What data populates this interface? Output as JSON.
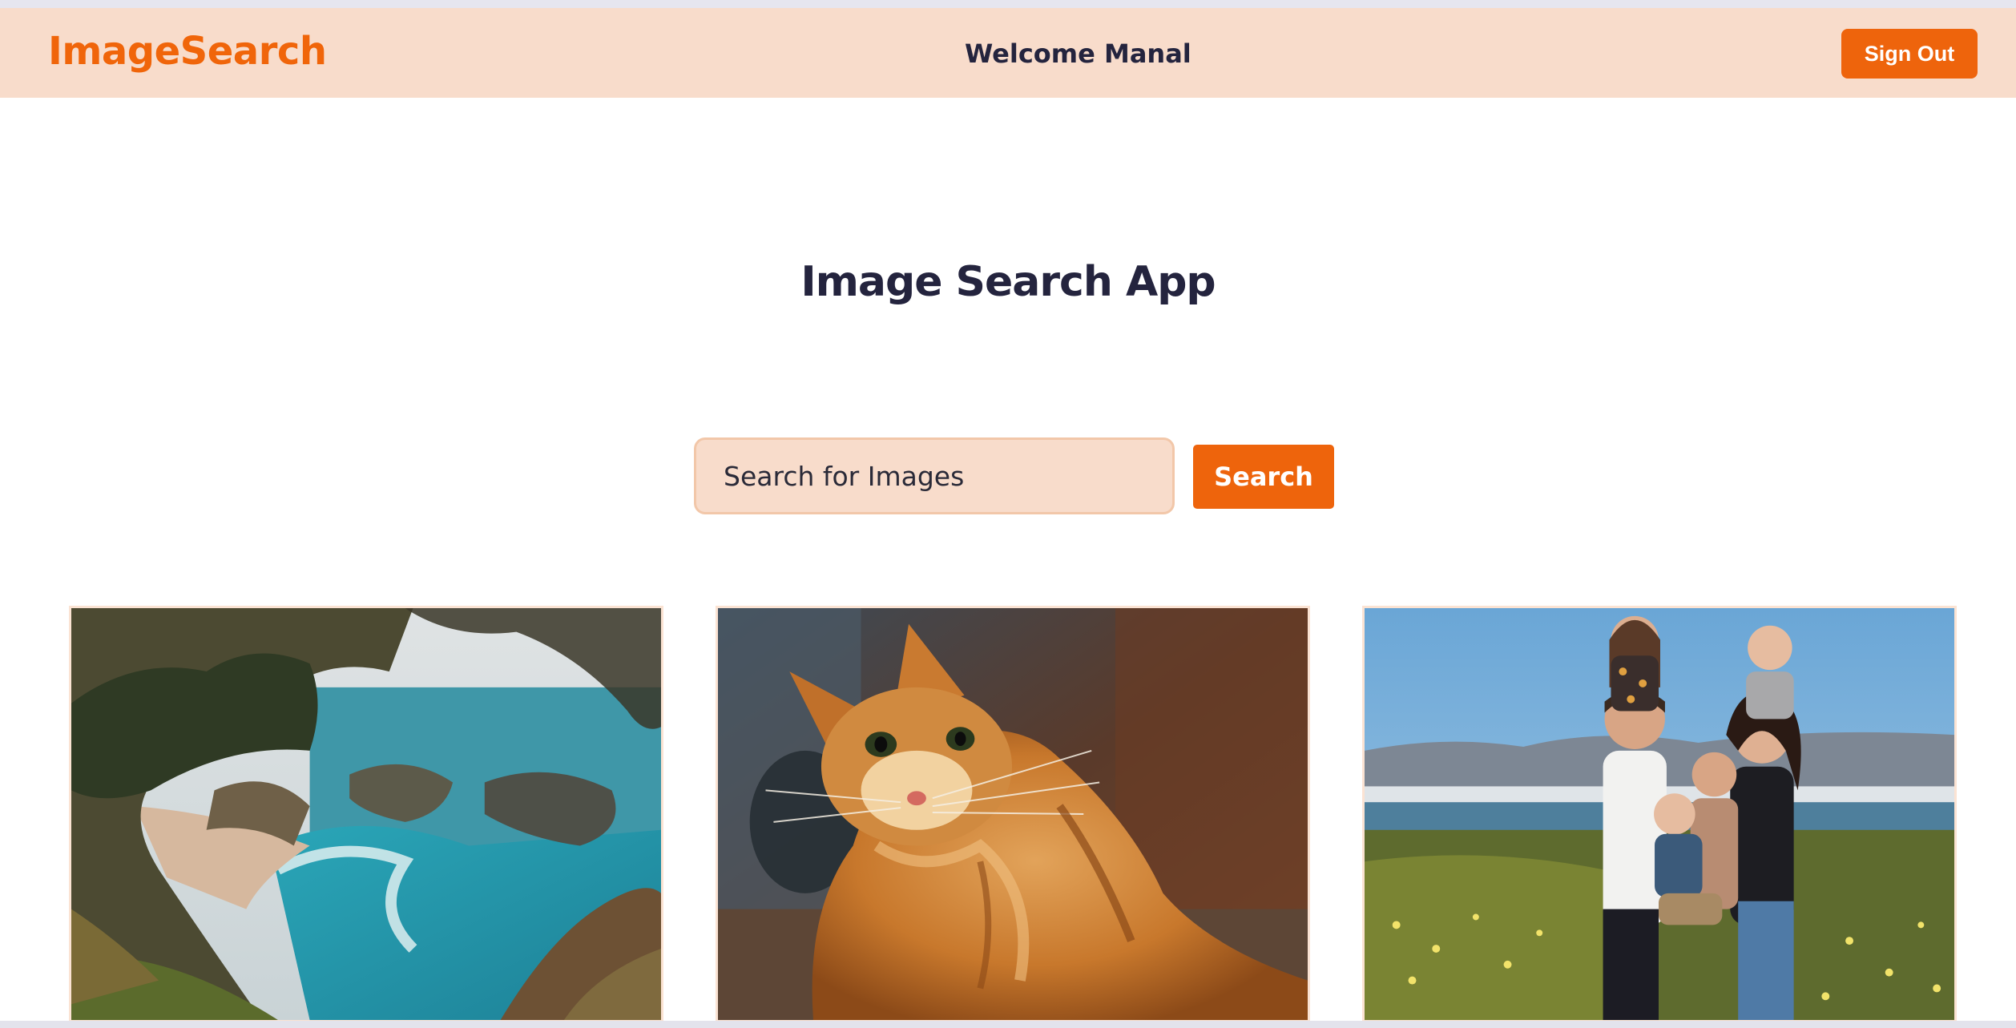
{
  "navbar": {
    "brand": "ImageSearch",
    "welcome": "Welcome Manal",
    "sign_out_label": "Sign Out"
  },
  "main": {
    "title": "Image Search App",
    "search": {
      "placeholder": "Search for Images",
      "value": "",
      "button_label": "Search"
    }
  },
  "results": [
    {
      "subject": "coastal cove with waterfall and trees"
    },
    {
      "subject": "orange tabby cat looking up"
    },
    {
      "subject": "family of five outdoors in a flower field"
    }
  ],
  "colors": {
    "accent": "#ee640c",
    "navbar_bg": "#f8dccb",
    "text_dark": "#24243e"
  }
}
